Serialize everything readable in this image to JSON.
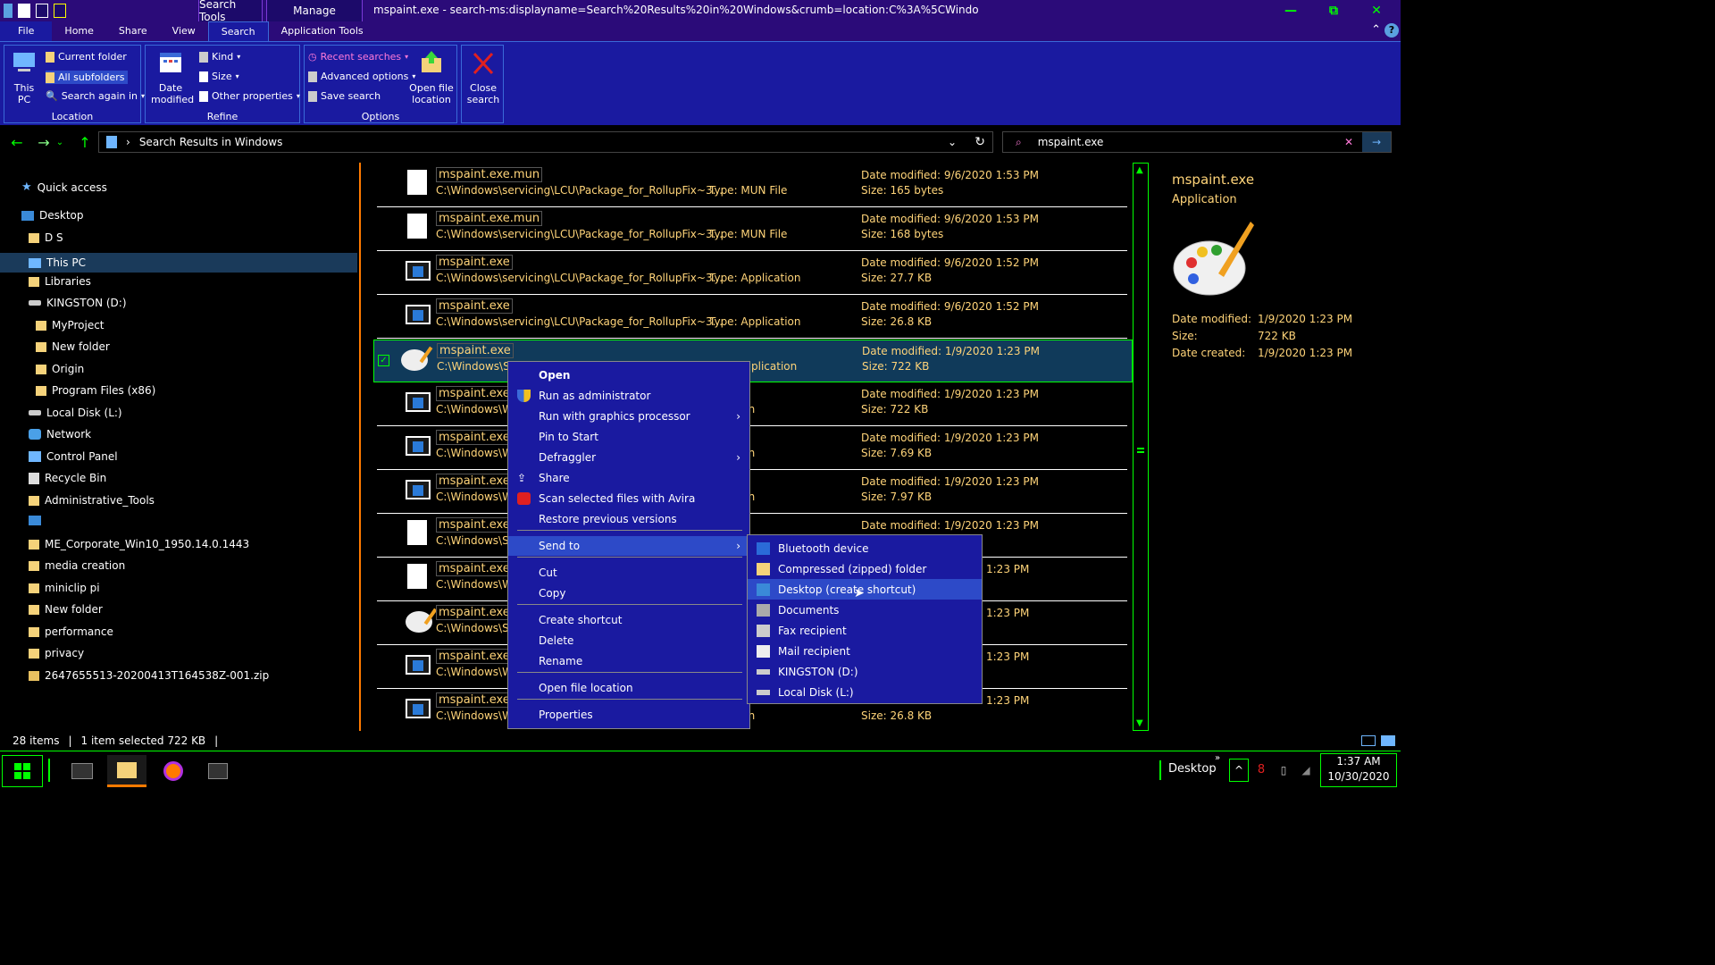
{
  "window": {
    "title": "mspaint.exe - search-ms:displayname=Search%20Results%20in%20Windows&crumb=location:C%3A%5CWindo",
    "contextual_tabs": [
      "Search Tools",
      "Manage"
    ],
    "controls": [
      "—",
      "⧉",
      "✕"
    ]
  },
  "ribbon_tabs": [
    "File",
    "Home",
    "Share",
    "View",
    "Search",
    "Application Tools"
  ],
  "ribbon": {
    "location": {
      "label": "Location",
      "this_pc": "This PC",
      "current_folder": "Current folder",
      "all_subfolders": "All subfolders",
      "search_again": "Search again in"
    },
    "refine": {
      "label": "Refine",
      "date_modified": "Date modified",
      "kind": "Kind",
      "size": "Size",
      "other_properties": "Other properties"
    },
    "options": {
      "label": "Options",
      "recent_searches": "Recent searches",
      "advanced_options": "Advanced options",
      "save_search": "Save search",
      "open_file_location": "Open file location",
      "close_search": "Close search"
    }
  },
  "address": {
    "breadcrumb": "Search Results in Windows",
    "search_value": "mspaint.exe"
  },
  "tree": [
    {
      "label": "Quick access",
      "icon": "star-icon"
    },
    {
      "label": "Desktop",
      "icon": "desktop-icon"
    },
    {
      "label": "D S",
      "icon": "user-folder-icon"
    },
    {
      "label": "This PC",
      "icon": "pc-icon"
    },
    {
      "label": "Libraries",
      "icon": "folder-icon"
    },
    {
      "label": "KINGSTON (D:)",
      "icon": "drive-icon"
    },
    {
      "label": "MyProject",
      "icon": "folder-icon"
    },
    {
      "label": "New folder",
      "icon": "folder-icon"
    },
    {
      "label": "Origin",
      "icon": "folder-icon"
    },
    {
      "label": "Program Files (x86)",
      "icon": "folder-icon"
    },
    {
      "label": "Local Disk (L:)",
      "icon": "drive-icon"
    },
    {
      "label": "Network",
      "icon": "network-icon"
    },
    {
      "label": "Control Panel",
      "icon": "control-panel-icon"
    },
    {
      "label": "Recycle Bin",
      "icon": "recycle-bin-icon"
    },
    {
      "label": "Administrative_Tools",
      "icon": "folder-icon"
    },
    {
      "label": "",
      "icon": "monitor-icon"
    },
    {
      "label": "ME_Corporate_Win10_1950.14.0.1443",
      "icon": "folder-icon"
    },
    {
      "label": "media creation",
      "icon": "folder-icon"
    },
    {
      "label": "miniclip pi",
      "icon": "folder-icon"
    },
    {
      "label": "New folder",
      "icon": "folder-icon"
    },
    {
      "label": "performance",
      "icon": "folder-icon"
    },
    {
      "label": "privacy",
      "icon": "folder-icon"
    },
    {
      "label": "2647655513-20200413T164538Z-001.zip",
      "icon": "zip-icon"
    }
  ],
  "files": [
    {
      "name": "mspaint.exe.mun",
      "path": "C:\\Windows\\servicing\\LCU\\Package_for_RollupFix~3...",
      "type": "Type: MUN File",
      "date": "Date modified: 9/6/2020 1:53 PM",
      "size": "Size: 165 bytes",
      "icon": "blank-file-icon"
    },
    {
      "name": "mspaint.exe.mun",
      "path": "C:\\Windows\\servicing\\LCU\\Package_for_RollupFix~3...",
      "type": "Type: MUN File",
      "date": "Date modified: 9/6/2020 1:53 PM",
      "size": "Size: 168 bytes",
      "icon": "blank-file-icon"
    },
    {
      "name": "mspaint.exe",
      "path": "C:\\Windows\\servicing\\LCU\\Package_for_RollupFix~3...",
      "type": "Type: Application",
      "date": "Date modified: 9/6/2020 1:52 PM",
      "size": "Size: 27.7 KB",
      "icon": "app-icon"
    },
    {
      "name": "mspaint.exe",
      "path": "C:\\Windows\\servicing\\LCU\\Package_for_RollupFix~3...",
      "type": "Type: Application",
      "date": "Date modified: 9/6/2020 1:52 PM",
      "size": "Size: 26.8 KB",
      "icon": "app-icon"
    },
    {
      "name": "mspaint.exe",
      "path": "C:\\Windows\\Sy",
      "type": "plication",
      "date": "Date modified: 1/9/2020 1:23 PM",
      "size": "Size: 722 KB",
      "icon": "paint-icon",
      "selected": true
    },
    {
      "name": "mspaint.exe",
      "path": "C:\\Windows\\W",
      "type": "plication",
      "date": "Date modified: 1/9/2020 1:23 PM",
      "size": "Size: 722 KB",
      "icon": "app-icon"
    },
    {
      "name": "mspaint.exe",
      "path": "C:\\Windows\\W",
      "type": "plication",
      "date": "Date modified: 1/9/2020 1:23 PM",
      "size": "Size: 7.69 KB",
      "icon": "app-icon"
    },
    {
      "name": "mspaint.exe",
      "path": "C:\\Windows\\W",
      "type": "plication",
      "date": "Date modified: 1/9/2020 1:23 PM",
      "size": "Size: 7.97 KB",
      "icon": "app-icon"
    },
    {
      "name": "mspaint.exe.",
      "path": "C:\\Windows\\Sy",
      "type": "",
      "date": "Date modified: 1/9/2020 1:23 PM",
      "size": "",
      "icon": "blank-file-icon"
    },
    {
      "name": "mspaint.exe.",
      "path": "C:\\Windows\\W",
      "type": "",
      "date": "1:23 PM",
      "size": "",
      "icon": "blank-file-icon"
    },
    {
      "name": "mspaint.exe",
      "path": "C:\\Windows\\Sy",
      "type": "",
      "date": "1:23 PM",
      "size": "",
      "icon": "paint-icon"
    },
    {
      "name": "mspaint.exe",
      "path": "C:\\Windows\\W",
      "type": "",
      "date": "1:23 PM",
      "size": "",
      "icon": "app-icon"
    },
    {
      "name": "mspaint.exe",
      "path": "C:\\Windows\\W",
      "type": "plication",
      "date": "1:23 PM",
      "size": "Size: 26.8 KB",
      "icon": "app-icon"
    }
  ],
  "preview": {
    "name": "mspaint.exe",
    "kind": "Application",
    "date_modified_label": "Date modified:",
    "date_modified": "1/9/2020 1:23 PM",
    "size_label": "Size:",
    "size": "722 KB",
    "date_created_label": "Date created:",
    "date_created": "1/9/2020 1:23 PM"
  },
  "context_menu": [
    {
      "label": "Open",
      "bold": true
    },
    {
      "label": "Run as administrator",
      "icon": "shield-icon"
    },
    {
      "label": "Run with graphics processor",
      "submenu": true
    },
    {
      "label": "Pin to Start"
    },
    {
      "label": "Defraggler",
      "submenu": true
    },
    {
      "label": "Share",
      "icon": "share-icon"
    },
    {
      "label": "Scan selected files with Avira",
      "icon": "avira-icon"
    },
    {
      "label": "Restore previous versions"
    },
    {
      "label": "Send to",
      "submenu": true,
      "highlighted": true
    },
    {
      "label": "Cut"
    },
    {
      "label": "Copy"
    },
    {
      "label": "Create shortcut"
    },
    {
      "label": "Delete"
    },
    {
      "label": "Rename"
    },
    {
      "label": "Open file location"
    },
    {
      "label": "Properties"
    }
  ],
  "send_to": [
    {
      "label": "Bluetooth device",
      "icon": "bluetooth-icon"
    },
    {
      "label": "Compressed (zipped) folder",
      "icon": "zip-folder-icon"
    },
    {
      "label": "Desktop (create shortcut)",
      "icon": "desktop-icon",
      "highlighted": true
    },
    {
      "label": "Documents",
      "icon": "documents-icon"
    },
    {
      "label": "Fax recipient",
      "icon": "fax-icon"
    },
    {
      "label": "Mail recipient",
      "icon": "mail-icon"
    },
    {
      "label": "KINGSTON (D:)",
      "icon": "drive-icon"
    },
    {
      "label": "Local Disk (L:)",
      "icon": "drive-icon"
    }
  ],
  "status": {
    "items": "28 items",
    "selected": "1 item selected  722 KB"
  },
  "taskbar": {
    "desktop_label": "Desktop",
    "time": "1:37 AM",
    "date": "10/30/2020",
    "badge": "8"
  },
  "colors": {
    "accent": "#00ff00",
    "titlebar": "#2b0b79",
    "ribbon": "#1a1aa0",
    "menu_highlight": "#2d4ac8",
    "file_text": "#ffd479",
    "preview_title": "#ffd479"
  }
}
